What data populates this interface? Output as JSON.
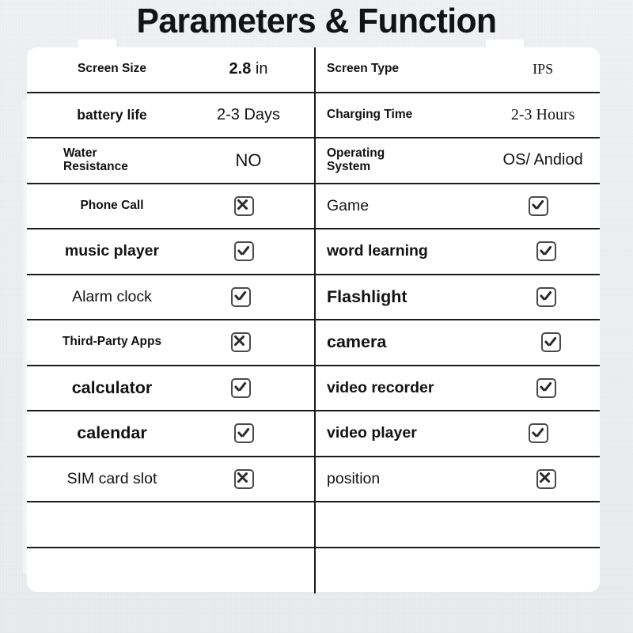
{
  "title": "Parameters & Function",
  "colors": {
    "background": "#eceef0",
    "card": "#ffffff",
    "rule": "#1b1b1b",
    "text": "#121212",
    "checkbox_border": "#4a4a4a"
  },
  "icons": {
    "check": "checkbox-checked-icon",
    "cross": "checkbox-crossed-icon"
  },
  "table": {
    "rows": [
      {
        "left": {
          "label": "Screen Size",
          "value_strong": "2.8",
          "value_light": " in"
        },
        "right": {
          "label": "Screen Type",
          "value": "IPS"
        }
      },
      {
        "left": {
          "label": "battery life",
          "value": "2-3 Days"
        },
        "right": {
          "label": "Charging Time",
          "value": "2-3  Hours"
        }
      },
      {
        "left": {
          "label": "Water\nResistance",
          "value": "NO"
        },
        "right": {
          "label": "Operating\nSystem",
          "value": "OS/ Andiod"
        }
      },
      {
        "left": {
          "label": "Phone Call",
          "mark": "cross"
        },
        "right": {
          "label": "Game",
          "mark": "check"
        }
      },
      {
        "left": {
          "label": "music player",
          "mark": "check"
        },
        "right": {
          "label": "word learning",
          "mark": "check"
        }
      },
      {
        "left": {
          "label": "Alarm clock",
          "mark": "check"
        },
        "right": {
          "label": "Flashlight",
          "mark": "check"
        }
      },
      {
        "left": {
          "label": "Third-Party Apps",
          "mark": "cross"
        },
        "right": {
          "label": "camera",
          "mark": "check"
        }
      },
      {
        "left": {
          "label": "calculator",
          "mark": "check"
        },
        "right": {
          "label": "video recorder",
          "mark": "check"
        }
      },
      {
        "left": {
          "label": "calendar",
          "mark": "check"
        },
        "right": {
          "label": "video player",
          "mark": "check"
        }
      },
      {
        "left": {
          "label": "SIM card slot",
          "mark": "cross"
        },
        "right": {
          "label": "position",
          "mark": "cross"
        }
      },
      {
        "left": {
          "label": ""
        },
        "right": {
          "label": ""
        }
      },
      {
        "left": {
          "label": ""
        },
        "right": {
          "label": ""
        }
      }
    ]
  }
}
